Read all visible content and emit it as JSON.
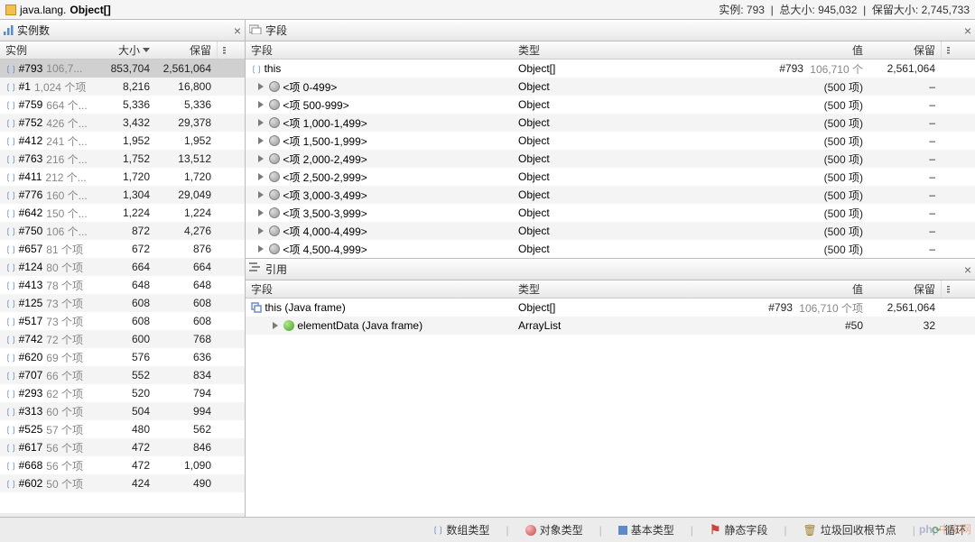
{
  "titlebar": {
    "package": "java.lang.",
    "classname": "Object[]",
    "stat_instances_lbl": "实例:",
    "stat_instances_val": "793",
    "stat_totalsize_lbl": "总大小:",
    "stat_totalsize_val": "945,032",
    "stat_retained_lbl": "保留大小:",
    "stat_retained_val": "2,745,733"
  },
  "panes": {
    "instances": "实例数",
    "fields": "字段",
    "refs": "引用"
  },
  "headers": {
    "instance": "实例",
    "size": "大小",
    "retained": "保留",
    "field": "字段",
    "type": "类型",
    "value": "值"
  },
  "instances": [
    {
      "name": "#793",
      "dim": "106,7...",
      "size": "853,704",
      "retained": "2,561,064",
      "sel": true
    },
    {
      "name": "#1",
      "dim": "1,024 个项",
      "size": "8,216",
      "retained": "16,800",
      "sel": false
    },
    {
      "name": "#759",
      "dim": "664 个...",
      "size": "5,336",
      "retained": "5,336",
      "sel": false
    },
    {
      "name": "#752",
      "dim": "426 个...",
      "size": "3,432",
      "retained": "29,378",
      "sel": false
    },
    {
      "name": "#412",
      "dim": "241 个...",
      "size": "1,952",
      "retained": "1,952",
      "sel": false
    },
    {
      "name": "#763",
      "dim": "216 个...",
      "size": "1,752",
      "retained": "13,512",
      "sel": false
    },
    {
      "name": "#411",
      "dim": "212 个...",
      "size": "1,720",
      "retained": "1,720",
      "sel": false
    },
    {
      "name": "#776",
      "dim": "160 个...",
      "size": "1,304",
      "retained": "29,049",
      "sel": false
    },
    {
      "name": "#642",
      "dim": "150 个...",
      "size": "1,224",
      "retained": "1,224",
      "sel": false
    },
    {
      "name": "#750",
      "dim": "106 个...",
      "size": "872",
      "retained": "4,276",
      "sel": false
    },
    {
      "name": "#657",
      "dim": "81 个项",
      "size": "672",
      "retained": "876",
      "sel": false
    },
    {
      "name": "#124",
      "dim": "80 个项",
      "size": "664",
      "retained": "664",
      "sel": false
    },
    {
      "name": "#413",
      "dim": "78 个项",
      "size": "648",
      "retained": "648",
      "sel": false
    },
    {
      "name": "#125",
      "dim": "73 个项",
      "size": "608",
      "retained": "608",
      "sel": false
    },
    {
      "name": "#517",
      "dim": "73 个项",
      "size": "608",
      "retained": "608",
      "sel": false
    },
    {
      "name": "#742",
      "dim": "72 个项",
      "size": "600",
      "retained": "768",
      "sel": false
    },
    {
      "name": "#620",
      "dim": "69 个项",
      "size": "576",
      "retained": "636",
      "sel": false
    },
    {
      "name": "#707",
      "dim": "66 个项",
      "size": "552",
      "retained": "834",
      "sel": false
    },
    {
      "name": "#293",
      "dim": "62 个项",
      "size": "520",
      "retained": "794",
      "sel": false
    },
    {
      "name": "#313",
      "dim": "60 个项",
      "size": "504",
      "retained": "994",
      "sel": false
    },
    {
      "name": "#525",
      "dim": "57 个项",
      "size": "480",
      "retained": "562",
      "sel": false
    },
    {
      "name": "#617",
      "dim": "56 个项",
      "size": "472",
      "retained": "846",
      "sel": false
    },
    {
      "name": "#668",
      "dim": "56 个项",
      "size": "472",
      "retained": "1,090",
      "sel": false
    },
    {
      "name": "#602",
      "dim": "50 个项",
      "size": "424",
      "retained": "490",
      "sel": false
    }
  ],
  "fields": {
    "this": {
      "type": "Object[]",
      "valname": "#793",
      "valdim": "106,710 个",
      "retained": "2,561,064"
    },
    "items": [
      {
        "label": "<项 0-499>",
        "type": "Object",
        "value": "(500 项)",
        "retained": "–"
      },
      {
        "label": "<项 500-999>",
        "type": "Object",
        "value": "(500 项)",
        "retained": "–"
      },
      {
        "label": "<项 1,000-1,499>",
        "type": "Object",
        "value": "(500 项)",
        "retained": "–"
      },
      {
        "label": "<项 1,500-1,999>",
        "type": "Object",
        "value": "(500 项)",
        "retained": "–"
      },
      {
        "label": "<项 2,000-2,499>",
        "type": "Object",
        "value": "(500 项)",
        "retained": "–"
      },
      {
        "label": "<项 2,500-2,999>",
        "type": "Object",
        "value": "(500 项)",
        "retained": "–"
      },
      {
        "label": "<项 3,000-3,499>",
        "type": "Object",
        "value": "(500 项)",
        "retained": "–"
      },
      {
        "label": "<项 3,500-3,999>",
        "type": "Object",
        "value": "(500 项)",
        "retained": "–"
      },
      {
        "label": "<项 4,000-4,499>",
        "type": "Object",
        "value": "(500 项)",
        "retained": "–"
      },
      {
        "label": "<项 4,500-4,999>",
        "type": "Object",
        "value": "(500 项)",
        "retained": "–"
      }
    ]
  },
  "refs": [
    {
      "indent": 0,
      "icon": "frame",
      "label": "this (Java frame)",
      "type": "Object[]",
      "valname": "#793",
      "valdim": "106,710 个项",
      "retained": "2,561,064",
      "arrow": false
    },
    {
      "indent": 1,
      "icon": "green",
      "label": "elementData (Java frame)",
      "type": "ArrayList",
      "valname": "#50",
      "valdim": "",
      "retained": "32",
      "arrow": true
    }
  ],
  "legend": {
    "array": "数组类型",
    "object": "对象类型",
    "primitive": "基本类型",
    "static": "静态字段",
    "gcroot": "垃圾回收根节点",
    "loop": "循环"
  },
  "watermark": {
    "php": "php",
    "cn": "中文网"
  }
}
